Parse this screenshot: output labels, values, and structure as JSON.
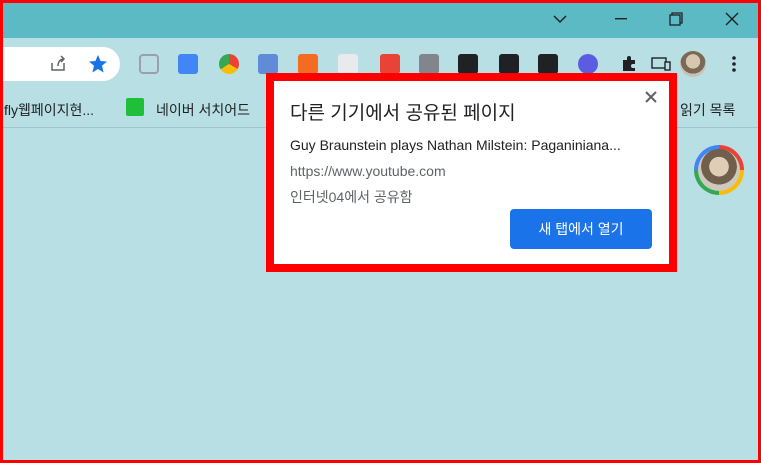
{
  "colors": {
    "titlebar": "#5bbac3",
    "page_bg": "#b8e0e4",
    "frame": "#ff0000",
    "primary_button": "#1a73e8",
    "star": "#1a73e8"
  },
  "window_controls": [
    "chevron-down-icon",
    "minimize-icon",
    "restore-icon",
    "close-icon"
  ],
  "toolbar": {
    "icons": [
      "share-icon",
      "bookmark-star-icon"
    ],
    "extensions": [
      "pocket-icon",
      "google-translate-icon",
      "chrome-icon",
      "text-icon",
      "layout-icon",
      "ext-icon",
      "ext-icon",
      "ublock-icon",
      "ghost-icon",
      "ext-icon",
      "ext-icon",
      "avatar-ext-icon",
      "puzzle-icon",
      "cast-icon"
    ],
    "menu_icon": "more-vert-icon"
  },
  "bookmarks": {
    "left_label": "fly웹페이지현...",
    "item_label": "네이버 서치어드",
    "right_label": "읽기 목록"
  },
  "popup": {
    "title": "다른 기기에서 공유된 페이지",
    "page_title": "Guy Braunstein plays Nathan Milstein: Paganiniana...",
    "url": "https://www.youtube.com",
    "shared_from": "인터넷04에서 공유함",
    "open_button": "새 탭에서 열기"
  }
}
